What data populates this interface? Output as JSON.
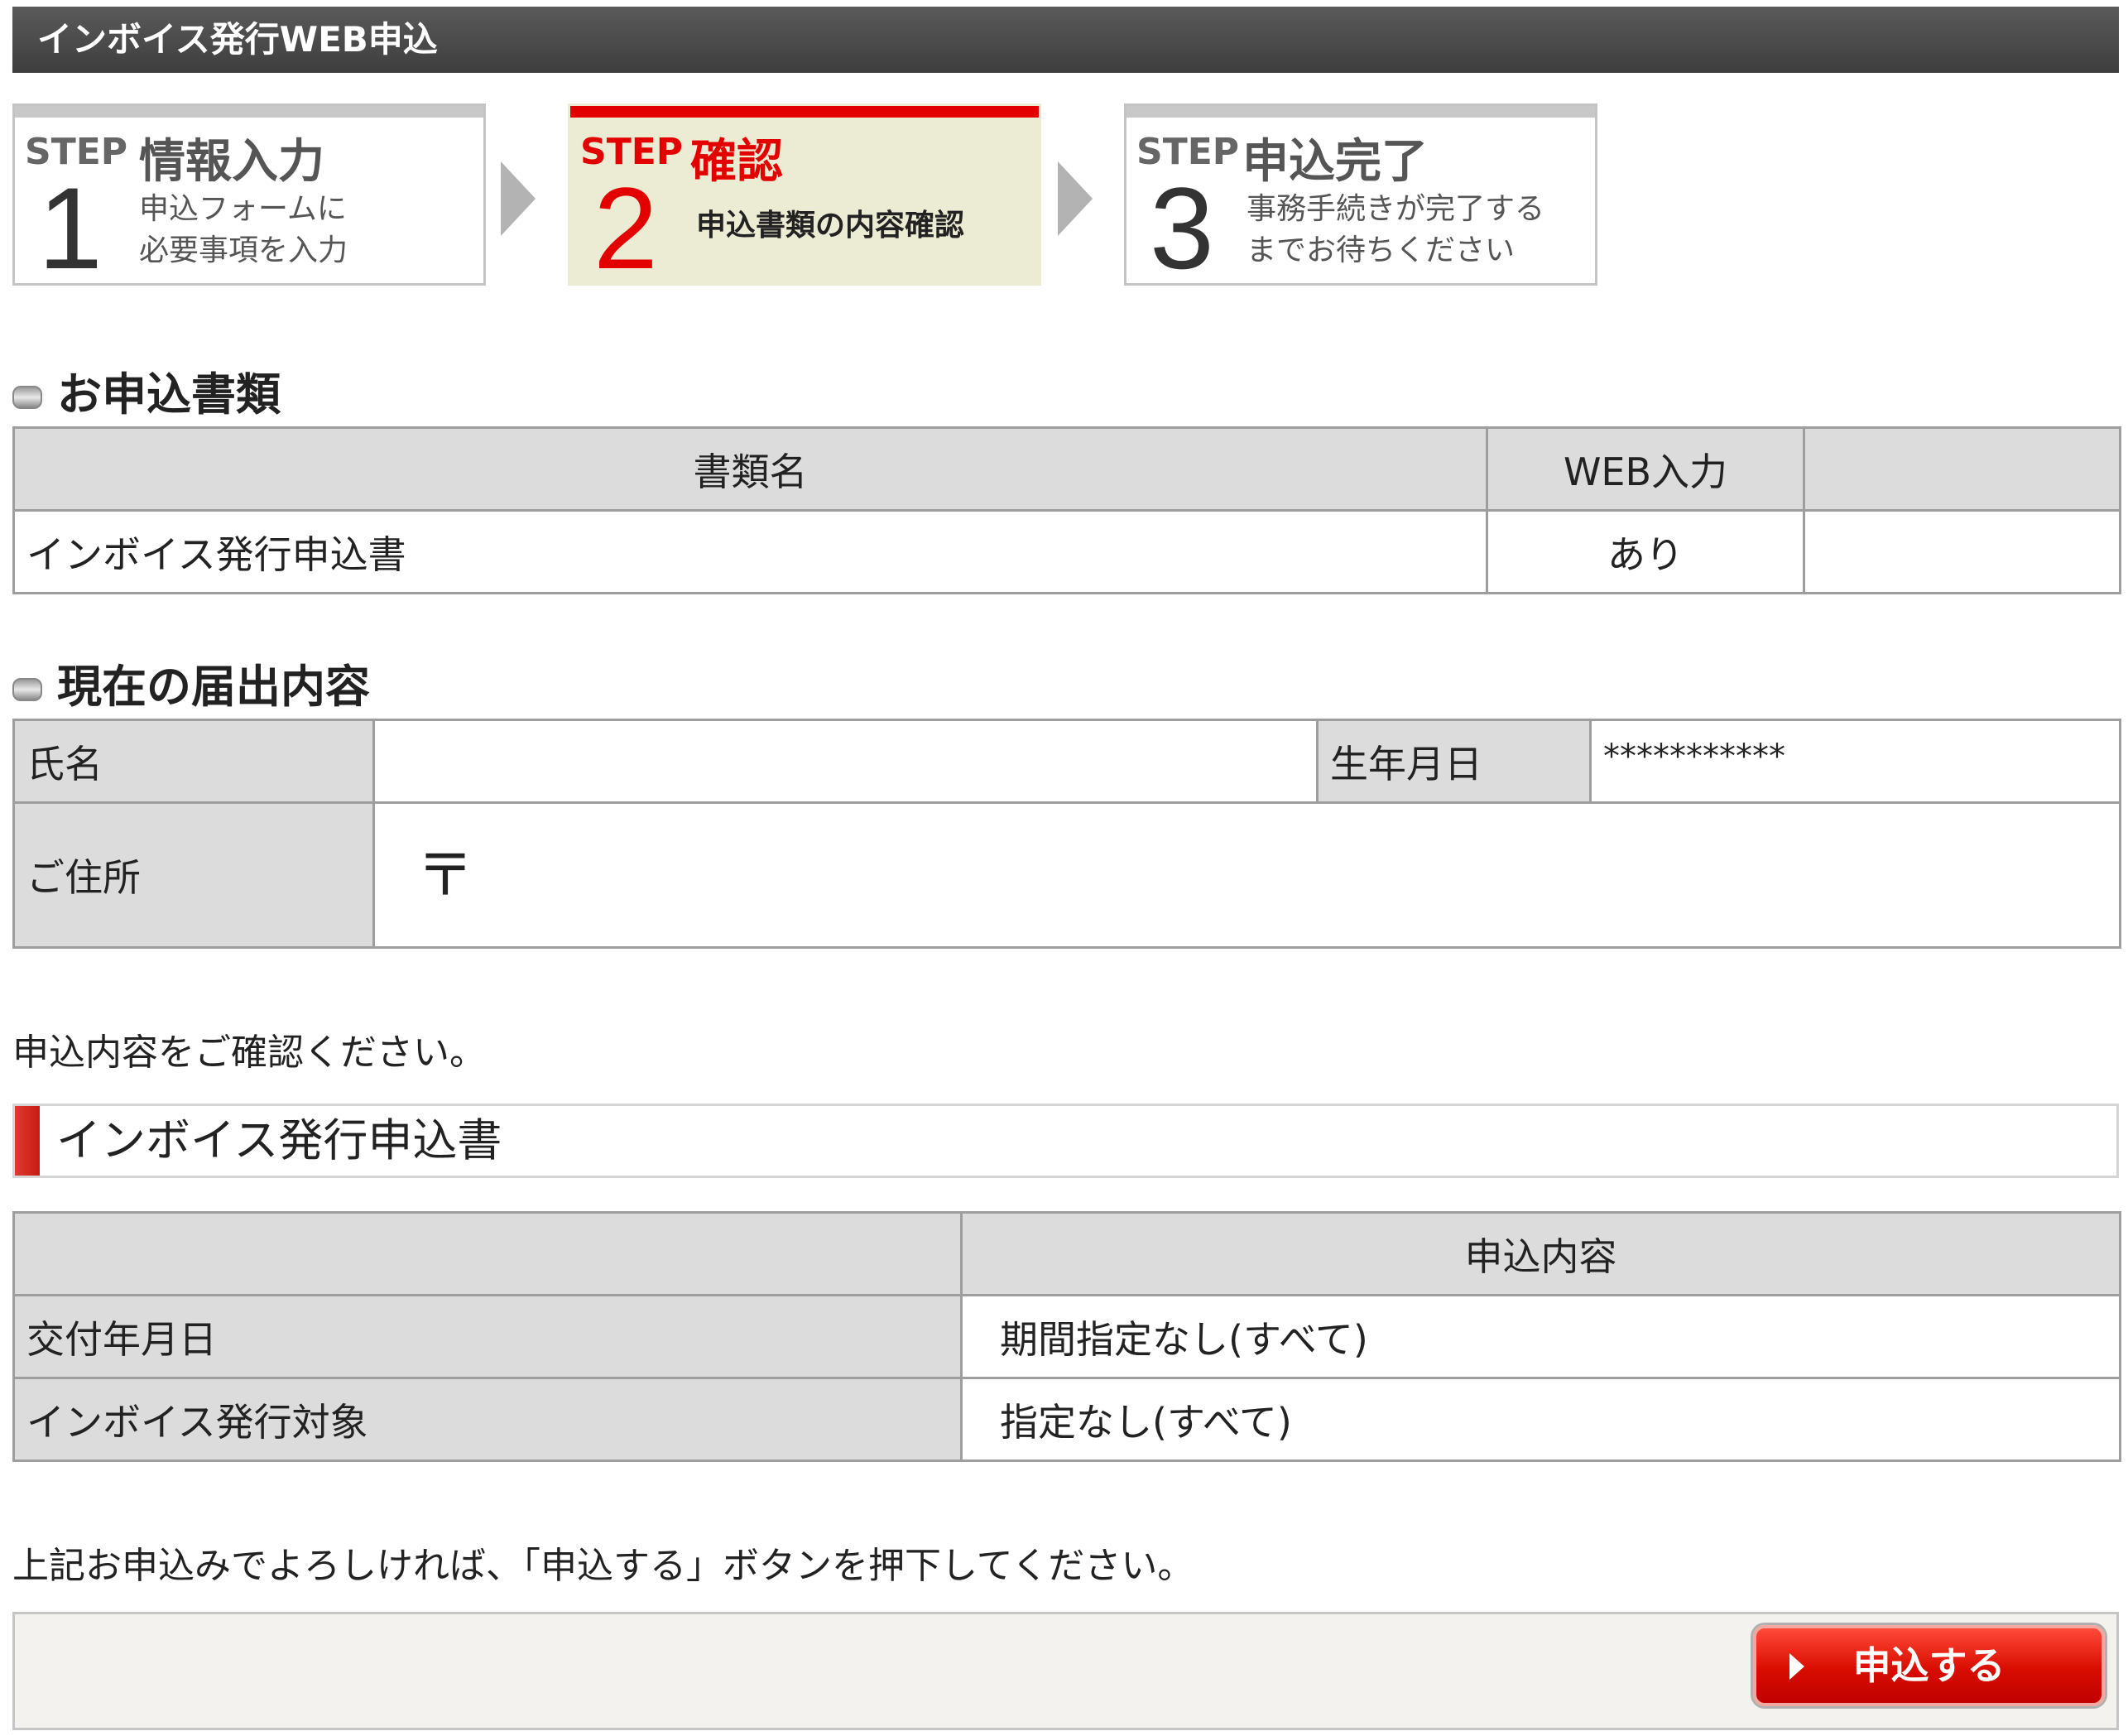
{
  "page_title": "インボイス発行WEB申込",
  "steps": [
    {
      "label": "STEP",
      "title": "情報入力",
      "num": "1",
      "desc": "申込フォームに\n必要事項を入力"
    },
    {
      "label": "STEP",
      "title": "確認",
      "num": "2",
      "desc": "申込書類の内容確認"
    },
    {
      "label": "STEP",
      "title": "申込完了",
      "num": "3",
      "desc": "事務手続きが完了する\nまでお待ちください"
    }
  ],
  "documents_section": {
    "heading": "お申込書類",
    "headers": [
      "書類名",
      "WEB入力",
      ""
    ],
    "rows": [
      [
        "インボイス発行申込書",
        "あり",
        ""
      ]
    ]
  },
  "current_section": {
    "heading": "現在の届出内容",
    "name_label": "氏名",
    "name_value": "",
    "dob_label": "生年月日",
    "dob_value": "***********",
    "address_label": "ご住所",
    "postal_mark": "〒"
  },
  "confirm_note": "申込内容をご確認ください。",
  "form": {
    "heading": "インボイス発行申込書",
    "headers": [
      "",
      "申込内容"
    ],
    "rows": [
      [
        "交付年月日",
        "期間指定なし(すべて)"
      ],
      [
        "インボイス発行対象",
        "指定なし(すべて)"
      ]
    ]
  },
  "submit_note": "上記お申込みでよろしければ、「申込する」ボタンを押下してください。",
  "submit_label": "申込する",
  "colors": {
    "accent": "#e30000",
    "active_step_bg": "#ecebd3",
    "header_bg": "#dcdcdc"
  }
}
